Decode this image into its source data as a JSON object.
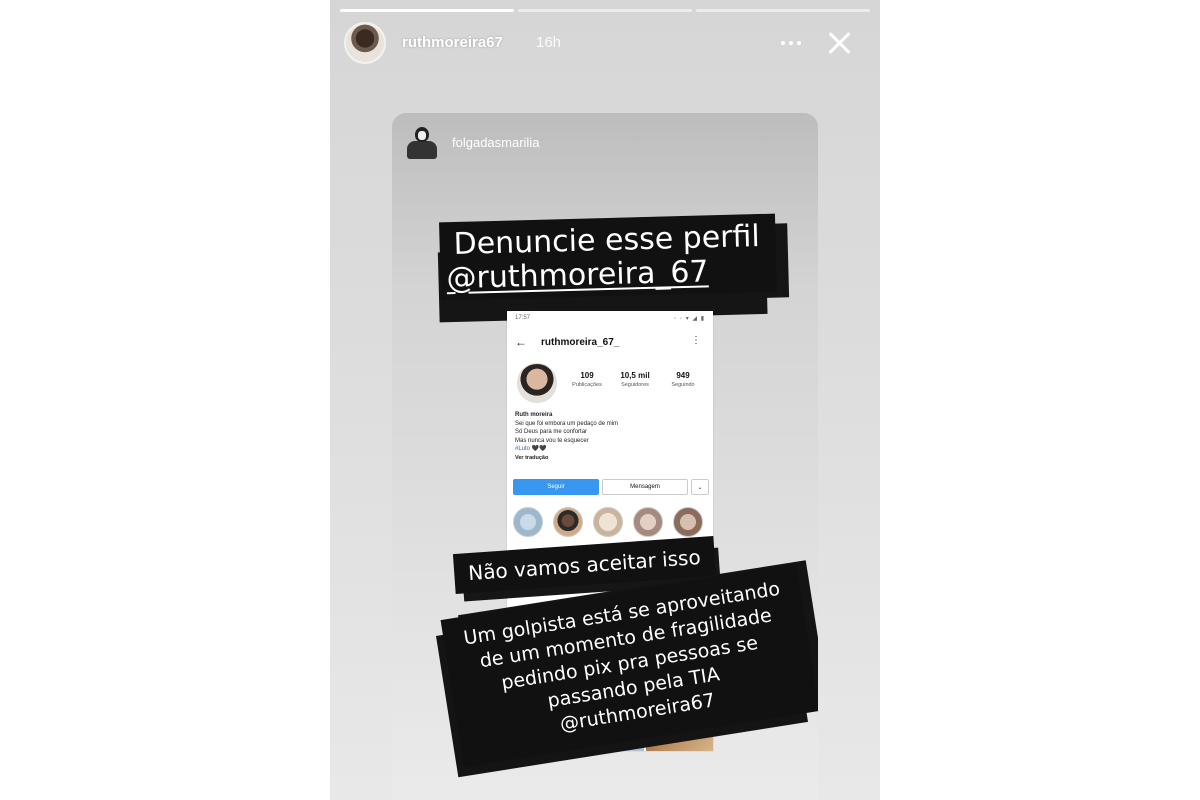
{
  "story": {
    "progress": [
      1.0,
      0.0,
      0.0
    ],
    "username": "ruthmoreira67",
    "time": "16h",
    "more_icon": "more-horizontal-icon",
    "close_icon": "close-icon"
  },
  "shared_post": {
    "account": "folgadasmarilia",
    "sticker_top": {
      "line1": "Denuncie esse perfil",
      "line2": "@ruthmoreira_67"
    },
    "sticker_middle": "Não vamos aceitar isso",
    "sticker_bottom": [
      "Um golpista está se aproveitando",
      "de um momento de fragilidade",
      "pedindo pix pra pessoas se",
      "passando pela TIA",
      "@ruthmoreira67"
    ]
  },
  "screenshot": {
    "status_time": "17:57",
    "status_icons": "◦ ◦ ▾ ◢ ▮",
    "back_icon": "back-arrow-icon",
    "username": "ruthmoreira_67_",
    "menu_icon": "⋮",
    "stats": [
      {
        "value": "109",
        "label": "Publicações"
      },
      {
        "value": "10,5 mil",
        "label": "Seguidores"
      },
      {
        "value": "949",
        "label": "Seguindo"
      }
    ],
    "bio": {
      "name": "Ruth moreira",
      "lines": [
        "Sei que foi embora um pedaço de mim",
        "Só Deus para me confortar",
        "Mas nunca vou te esquecer"
      ],
      "tag": "#Luto 🖤🖤",
      "translate": "Ver tradução"
    },
    "buttons": {
      "follow": "Seguir",
      "message": "Mensagem",
      "more": "⌄"
    }
  }
}
